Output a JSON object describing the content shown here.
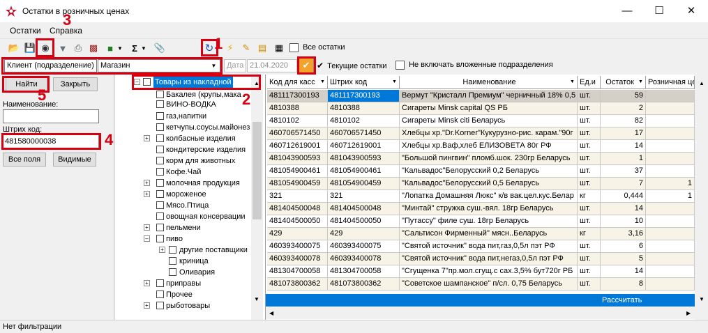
{
  "window": {
    "title": "Остатки в розничных ценах"
  },
  "menu": {
    "items": [
      "Остатки",
      "Справка"
    ]
  },
  "toolbar": {
    "all_stock_label": "Все остатки"
  },
  "filter": {
    "client_label": "Клиент (подразделение)",
    "client_value": "Магазин",
    "date_label": "Дата",
    "date_value": "21.04.2020",
    "current_stock_label": "Текущие остатки",
    "exclude_nested_label": "Не включать вложенные подразделения"
  },
  "left": {
    "find_label": "Найти",
    "close_label": "Закрыть",
    "name_label": "Наименование:",
    "name_value": "",
    "barcode_label": "Штрих код:",
    "barcode_value": "481580000038",
    "all_fields_label": "Все поля",
    "visible_label": "Видимые"
  },
  "tree": {
    "root": "Товары из накладной",
    "items": [
      "Бакалея (крупы,мака",
      "ВИНО-ВОДКА",
      "газ,напитки",
      "кетчупы.соусы.майонез",
      "колбасные изделия",
      "кондитерские изделия",
      "корм для животных",
      "Кофе.Чай",
      "молочная продукция",
      "мороженое",
      "Мясо.Птица",
      "овощная консервации",
      "пельмени",
      "пиво",
      "другие поставщики",
      "криница",
      "Оливария",
      "приправы",
      "Прочее",
      "рыботовары"
    ]
  },
  "grid": {
    "columns": [
      "Код для касс",
      "Штрих код",
      "Наименование",
      "Ед.и",
      "Остаток",
      "Розничная цен"
    ],
    "rows": [
      [
        "481117300193",
        "481117300193",
        "Вермут \"Кристалл Премиум\" черничный 18% 0,5",
        "шт.",
        "59",
        ""
      ],
      [
        "4810388",
        "4810388",
        "Сигареты  Minsk capital QS РБ",
        "шт.",
        "2",
        ""
      ],
      [
        "4810102",
        "4810102",
        "Сигареты  Minsk citi  Беларусь",
        "шт.",
        "82",
        ""
      ],
      [
        "460706571450",
        "460706571450",
        "Хлебцы хр.\"Dr.Korner\"Кукурузно-рис. карам.\"90г",
        "шт.",
        "17",
        ""
      ],
      [
        "460712619001",
        "460712619001",
        "Хлебцы хр.Ваф,хлеб ЕЛИЗОВЕТА  80г РФ",
        "шт.",
        "14",
        ""
      ],
      [
        "481043900593",
        "481043900593",
        "\"Большой пингвин\" пломб.шок. 230гр Беларусь",
        "шт.",
        "1",
        ""
      ],
      [
        "481054900461",
        "481054900461",
        "\"Кальвадос\"Белорусский 0,2 Беларусь",
        "шт.",
        "37",
        ""
      ],
      [
        "481054900459",
        "481054900459",
        "\"Кальвадос\"Белорусский 0,5 Беларусь",
        "шт.",
        "7",
        "1"
      ],
      [
        "321",
        "321",
        "\"Лопатка Домашняя Люкс\" к/в вак.цел.кус.Белар",
        "кг",
        "0,444",
        "1"
      ],
      [
        "481404500048",
        "481404500048",
        "\"Минтай\" стружка  суш.-вял. 18гр Беларусь",
        "шт.",
        "14",
        ""
      ],
      [
        "481404500050",
        "481404500050",
        "\"Путассу\" филе суш. 18гр Беларусь",
        "шт.",
        "10",
        ""
      ],
      [
        "429",
        "429",
        "\"Сальтисон Фирменный\" мясн..Беларусь",
        "кг",
        "3,16",
        ""
      ],
      [
        "460393400075",
        "460393400075",
        "\"Святой источник\" вода пит,газ,0,5л пэт РФ",
        "шт.",
        "6",
        ""
      ],
      [
        "460393400078",
        "460393400078",
        "\"Святой источник\" вода пит,негаз,0,5л пэт РФ",
        "шт.",
        "5",
        ""
      ],
      [
        "481304700058",
        "481304700058",
        "\"Сгущенка 7\"пр.мол.сгущ.с сах.3,5% бут720г РБ",
        "шт.",
        "14",
        ""
      ],
      [
        "481073800362",
        "481073800362",
        "\"Советское шампанское\" п/сл. 0,75 Беларусь",
        "шт.",
        "8",
        ""
      ]
    ],
    "footer_action": "Рассчитать"
  },
  "status": {
    "text": "Нет фильтрации"
  },
  "annotations": {
    "m1": "1",
    "m2": "2",
    "m3": "3",
    "m4": "4",
    "m5": "5"
  },
  "colors": {
    "selection": "#0078d7",
    "annotation": "#d80010",
    "alt_row": "#f7f3e6",
    "first_row": "#d4d0c8"
  }
}
